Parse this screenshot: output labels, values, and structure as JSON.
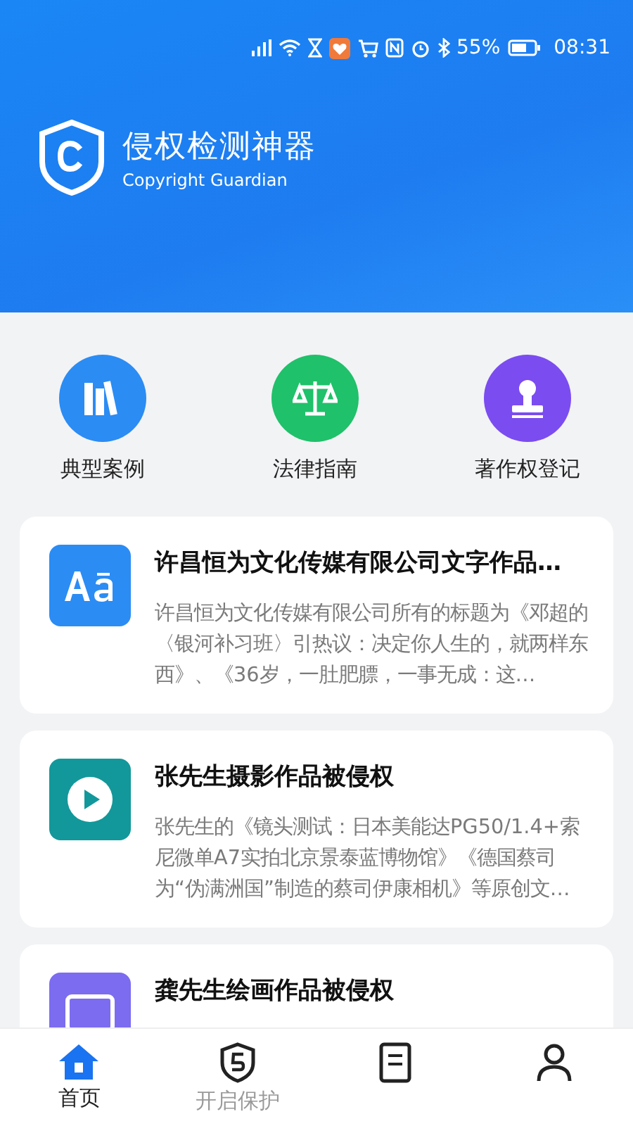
{
  "status_bar": {
    "battery_text": "55%",
    "time": "08:31"
  },
  "header": {
    "title": "侵权检测神器",
    "subtitle": "Copyright Guardian"
  },
  "shortcuts": [
    {
      "kind": "books",
      "label": "典型案例",
      "color": "#2b8cf4"
    },
    {
      "kind": "scale",
      "label": "法律指南",
      "color": "#1fc16a"
    },
    {
      "kind": "stamp",
      "label": "著作权登记",
      "color": "#7b4cf0"
    }
  ],
  "cases": [
    {
      "kind": "text",
      "title": "许昌恒为文化传媒有限公司文字作品…",
      "summary": "许昌恒为文化传媒有限公司所有的标题为《邓超的〈银河补习班〉引热议：决定你人生的，就两样东西》、《36岁，一肚肥膘，一事无成：这…"
    },
    {
      "kind": "video",
      "title": "张先生摄影作品被侵权",
      "summary": "张先生的《镜头测试：日本美能达PG50/1.4+索尼微单A7实拍北京景泰蓝博物馆》《德国蔡司为“伪满洲国”制造的蔡司伊康相机》等原创文…"
    },
    {
      "kind": "image",
      "title": "龚先生绘画作品被侵权"
    }
  ],
  "tab_bar": [
    {
      "kind": "home",
      "label": "首页",
      "selected": true
    },
    {
      "kind": "shield",
      "label": "开启保护",
      "selected": false
    },
    {
      "kind": "document",
      "selected": false
    },
    {
      "kind": "person",
      "selected": false
    }
  ]
}
